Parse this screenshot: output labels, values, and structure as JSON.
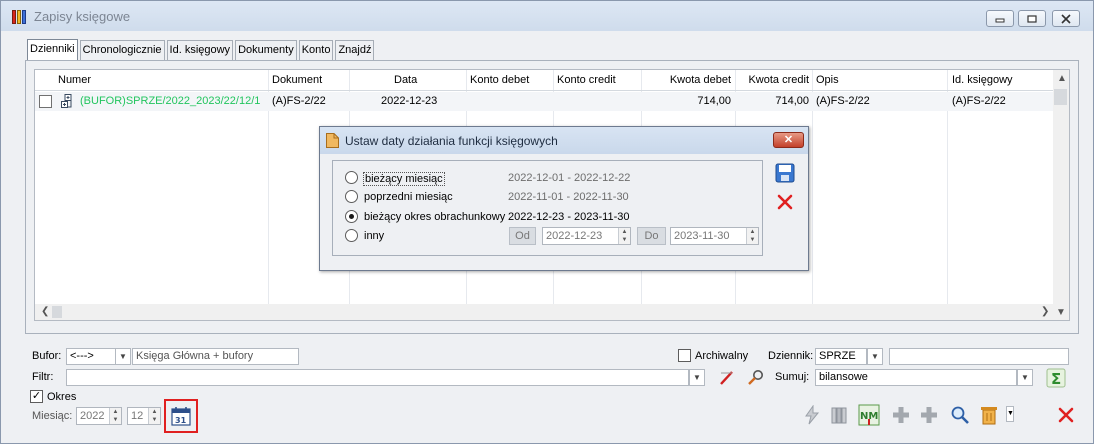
{
  "window": {
    "title": "Zapisy księgowe"
  },
  "tabs": [
    "Dzienniki",
    "Chronologicznie",
    "Id. księgowy",
    "Dokumenty",
    "Konto",
    "Znajdź"
  ],
  "grid": {
    "columns": [
      "Numer",
      "Dokument",
      "Data",
      "Konto debet",
      "Konto credit",
      "Kwota debet",
      "Kwota credit",
      "Opis",
      "Id. księgowy"
    ],
    "rows": [
      {
        "numer": "(BUFOR)SPRZE/2022_2023/22/12/1",
        "dokument": "(A)FS-2/22",
        "data": "2022-12-23",
        "konto_debet": "",
        "konto_credit": "",
        "kwota_debet": "714,00",
        "kwota_credit": "714,00",
        "opis": "(A)FS-2/22",
        "id_ksiegowy": "(A)FS-2/22"
      }
    ]
  },
  "dialog": {
    "title": "Ustaw daty działania funkcji księgowych",
    "options": [
      {
        "label": "bieżący miesiąc",
        "range": "2022-12-01 - 2022-12-22",
        "selected": false
      },
      {
        "label": "poprzedni miesiąc",
        "range": "2022-11-01 - 2022-11-30",
        "selected": false
      },
      {
        "label": "bieżący okres obrachunkowy",
        "range": "2022-12-23 - 2023-11-30",
        "selected": true
      },
      {
        "label": "inny",
        "range": "",
        "selected": false
      }
    ],
    "od_label": "Od",
    "od_value": "2022-12-23",
    "do_label": "Do",
    "do_value": "2023-11-30"
  },
  "filters": {
    "bufor_label": "Bufor:",
    "bufor_value": "<--->",
    "bufor_desc": "Księga Główna + bufory",
    "archiwalny_label": "Archiwalny",
    "dziennik_label": "Dziennik:",
    "dziennik_value": "SPRZE",
    "filtr_label": "Filtr:",
    "sumuj_label": "Sumuj:",
    "sumuj_value": "bilansowe",
    "okres_label": "Okres",
    "miesiac_label": "Miesiąc:",
    "year": "2022",
    "month": "12"
  },
  "colors": {
    "green_text": "#22c55e",
    "red_accent": "#e02020",
    "window_bg": "#eef0f3"
  }
}
